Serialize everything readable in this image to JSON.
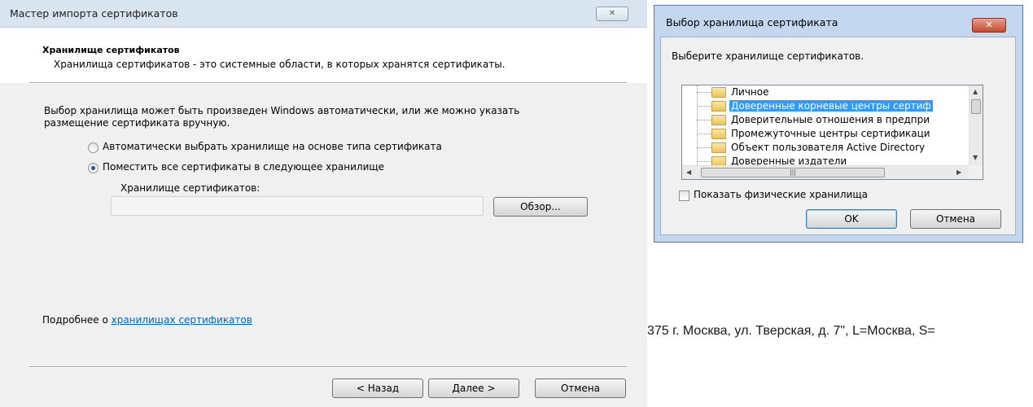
{
  "wizard": {
    "title": "Мастер импорта сертификатов",
    "close_glyph": "✕",
    "header_title": "Хранилище сертификатов",
    "header_subtitle": "Хранилища сертификатов - это системные области, в которых хранятся сертификаты.",
    "body_text": "Выбор хранилища может быть произведен Windows автоматически, или же можно указать размещение сертификата вручную.",
    "radio_auto": "Автоматически выбрать хранилище на основе типа сертификата",
    "radio_manual": "Поместить все сертификаты в следующее хранилище",
    "store_label": "Хранилище сертификатов:",
    "store_value": "",
    "browse_button": "Обзор...",
    "more_prefix": "Подробнее о ",
    "more_link": "хранилищах сертификатов",
    "back_button": "< Назад",
    "next_button": "Далее >",
    "cancel_button": "Отмена",
    "selected_radio": "manual"
  },
  "select_dialog": {
    "title": "Выбор хранилища сертификата",
    "close_glyph": "✕",
    "prompt": "Выберите хранилище сертификатов.",
    "tree_items": [
      {
        "label": "Личное"
      },
      {
        "label": "Доверенные корневые центры сертиф"
      },
      {
        "label": "Доверительные отношения в предпри"
      },
      {
        "label": "Промежуточные центры сертификаци"
      },
      {
        "label": "Объект пользователя Active Directory"
      },
      {
        "label": "Доверенные издатели"
      }
    ],
    "selected_index": 1,
    "show_physical_label": "Показать физические хранилища",
    "show_physical_checked": false,
    "ok_button": "OK",
    "cancel_button": "Отмена"
  },
  "background_text": "375 г. Москва, ул. Тверская, д. 7\", L=Москва, S="
}
